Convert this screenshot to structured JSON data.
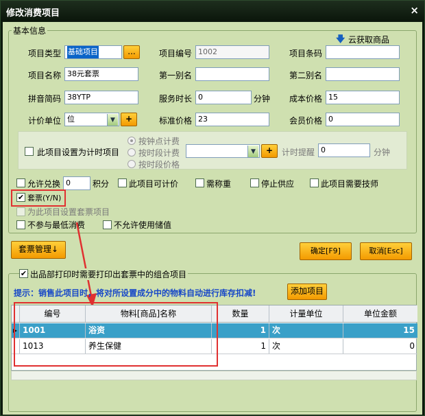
{
  "window": {
    "title": "修改消费项目",
    "close_glyph": "×"
  },
  "basic": {
    "legend": "基本信息",
    "cloud_fetch": "云获取商品",
    "fields": {
      "item_type": {
        "label": "项目类型",
        "value": "基础项目",
        "button": "..."
      },
      "item_code": {
        "label": "项目编号",
        "value": "1002"
      },
      "item_barcode": {
        "label": "项目条码",
        "value": ""
      },
      "item_name": {
        "label": "项目名称",
        "value": "38元套票"
      },
      "alias1": {
        "label": "第一别名",
        "value": ""
      },
      "alias2": {
        "label": "第二别名",
        "value": ""
      },
      "pinyin": {
        "label": "拼音简码",
        "value": "38YTP"
      },
      "service_duration": {
        "label": "服务时长",
        "value": "0",
        "unit": "分钟"
      },
      "cost_price": {
        "label": "成本价格",
        "value": "15"
      },
      "pricing_unit": {
        "label": "计价单位",
        "value": "位",
        "button": "+"
      },
      "standard_price": {
        "label": "标准价格",
        "value": "23"
      },
      "member_price": {
        "label": "会员价格",
        "value": "0"
      }
    },
    "timing": {
      "checkbox_label": "此项目设置为计时项目",
      "radio_per_clock": "按钟点计费",
      "radio_by_period": "按时段计费",
      "radio_by_price": "按时段价格",
      "period_select": "",
      "period_button": "+",
      "reminder_label": "计时提醒",
      "reminder_value": "0",
      "reminder_unit": "分钟"
    },
    "options": {
      "allow_exchange": "允许兑换",
      "points_value": "0",
      "points_label": "积分",
      "timed_item": "此项目可计价",
      "need_weigh": "需称重",
      "stop_supply": "停止供应",
      "need_technician": "此项目需要技师",
      "package_ticket": "套票(Y/N)",
      "package_ticket_checked": "✔",
      "set_package_disabled": "为此项目设置套票项目",
      "no_min_consumption": "不参与最低消费",
      "no_stored_value": "不允许使用储值"
    }
  },
  "buttons": {
    "package_manage": "套票管理↓",
    "confirm": "确定[F9]",
    "cancel": "取消[Esc]"
  },
  "combo": {
    "print_checkbox": "出品部打印时需要打印出套票中的组合项目",
    "print_checked": "✔",
    "hint": "提示：销售此项目时，将对所设置成分中的物料自动进行库存扣减!",
    "add_item": "添加项目",
    "table": {
      "headers": [
        "编号",
        "物料[商品]名称",
        "数量",
        "计量单位",
        "单位金额"
      ],
      "rows": [
        {
          "marker": "▸",
          "code": "1001",
          "name": "浴资",
          "qty": "1",
          "unit": "次",
          "amount": "15",
          "selected": true
        },
        {
          "marker": "",
          "code": "1013",
          "name": "养生保健",
          "qty": "1",
          "unit": "次",
          "amount": "0",
          "selected": false
        }
      ]
    }
  },
  "colors": {
    "accent_orange": "#f39a00",
    "selected_row": "#3aa0c8",
    "panel_green": "#cfe0b0",
    "annotation_red": "#e03030"
  }
}
